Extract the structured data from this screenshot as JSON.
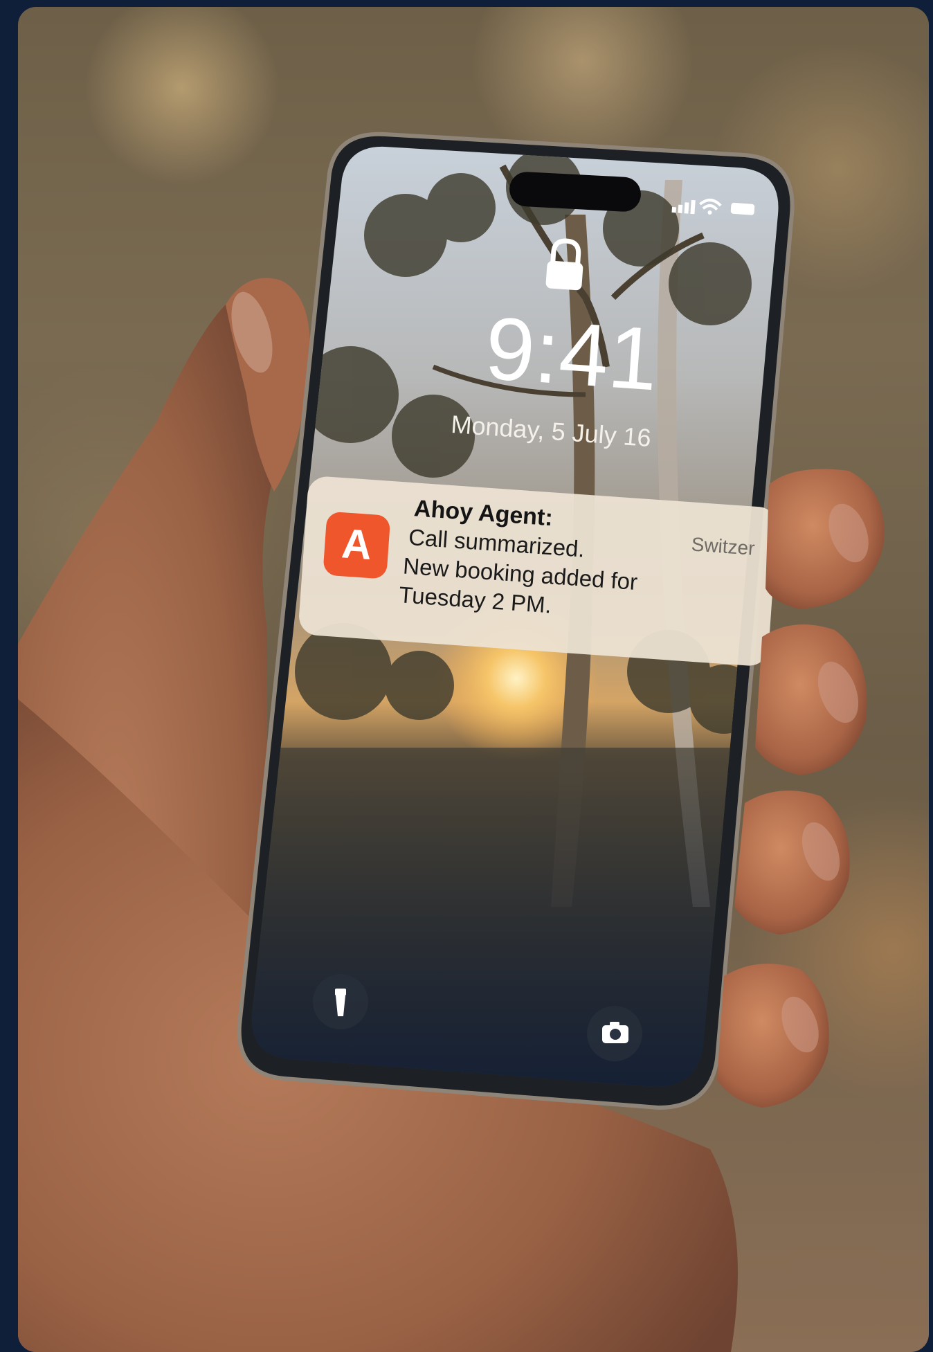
{
  "lockscreen": {
    "time": "9:41",
    "date": "Monday, 5 July 16"
  },
  "notification": {
    "app_name": "Ahoy Agent:",
    "source": "Switzer",
    "line1": "Call summarized.",
    "line2": "New booking added for",
    "line3": "Tuesday 2 PM.",
    "app_icon_letter": "A",
    "accent_color": "#f0562c"
  },
  "icons": {
    "lock": "lock-icon",
    "flashlight": "flashlight-icon",
    "camera": "camera-icon",
    "signal": "signal-icon",
    "wifi": "wifi-icon",
    "battery": "battery-icon"
  }
}
